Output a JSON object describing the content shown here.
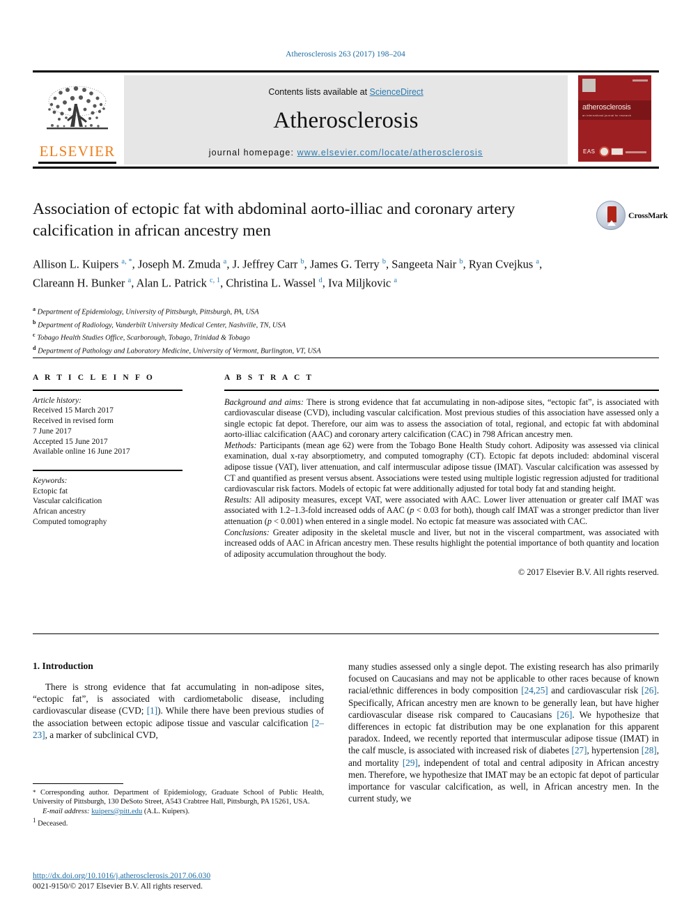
{
  "running_head": "Atherosclerosis 263 (2017) 198–204",
  "masthead": {
    "contents_prefix": "Contents lists available at ",
    "sciencedirect": "ScienceDirect",
    "journal_name": "Atherosclerosis",
    "homepage_prefix": "journal homepage: ",
    "homepage_url": "www.elsevier.com/locate/atherosclerosis",
    "publisher_logo_text": "ELSEVIER",
    "cover": {
      "title": "atherosclerosis",
      "subtitle": "an international journal for research",
      "badge": "EAS"
    },
    "accent_blue": "#2a7ab0",
    "elsevier_orange": "#ef7d1a",
    "cover_red": "#9d1f22"
  },
  "article": {
    "title": "Association of ectopic fat with abdominal aorto-illiac and coronary artery calcification in african ancestry men",
    "crossmark_label": "CrossMark",
    "authors_html": "Allison L. Kuipers <sup>a, *</sup>, Joseph M. Zmuda <sup>a</sup>, J. Jeffrey Carr <sup>b</sup>, James G. Terry <sup>b</sup>, Sangeeta Nair <sup>b</sup>, Ryan Cvejkus <sup>a</sup>, Clareann H. Bunker <sup>a</sup>, Alan L. Patrick <sup>c, 1</sup>, Christina L. Wassel <sup>d</sup>, Iva Miljkovic <sup>a</sup>",
    "affiliations": [
      {
        "marker": "a",
        "text": "Department of Epidemiology, University of Pittsburgh, Pittsburgh, PA, USA"
      },
      {
        "marker": "b",
        "text": "Department of Radiology, Vanderbilt University Medical Center, Nashville, TN, USA"
      },
      {
        "marker": "c",
        "text": "Tobago Health Studies Office, Scarborough, Tobago, Trinidad & Tobago"
      },
      {
        "marker": "d",
        "text": "Department of Pathology and Laboratory Medicine, University of Vermont, Burlington, VT, USA"
      }
    ]
  },
  "article_info": {
    "heading": "A R T I C L E   I N F O",
    "history_label": "Article history:",
    "history": [
      "Received 15 March 2017",
      "Received in revised form",
      "7 June 2017",
      "Accepted 15 June 2017",
      "Available online 16 June 2017"
    ],
    "keywords_label": "Keywords:",
    "keywords": [
      "Ectopic fat",
      "Vascular calcification",
      "African ancestry",
      "Computed tomography"
    ]
  },
  "abstract": {
    "heading": "A B S T R A C T",
    "background_label": "Background and aims:",
    "background_text": " There is strong evidence that fat accumulating in non-adipose sites, “ectopic fat”, is associated with cardiovascular disease (CVD), including vascular calcification. Most previous studies of this association have assessed only a single ectopic fat depot. Therefore, our aim was to assess the association of total, regional, and ectopic fat with abdominal aorto-illiac calcification (AAC) and coronary artery calcification (CAC) in 798 African ancestry men.",
    "methods_label": "Methods:",
    "methods_text": " Participants (mean age 62) were from the Tobago Bone Health Study cohort. Adiposity was assessed via clinical examination, dual x-ray absorptiometry, and computed tomography (CT). Ectopic fat depots included: abdominal visceral adipose tissue (VAT), liver attenuation, and calf intermuscular adipose tissue (IMAT). Vascular calcification was assessed by CT and quantified as present versus absent. Associations were tested using multiple logistic regression adjusted for traditional cardiovascular risk factors. Models of ectopic fat were additionally adjusted for total body fat and standing height.",
    "results_label": "Results:",
    "results_text_1": " All adiposity measures, except VAT, were associated with AAC. Lower liver attenuation or greater calf IMAT was associated with 1.2–1.3-fold increased odds of AAC (",
    "results_p1": "p",
    "results_text_2": " < 0.03 for both), though calf IMAT was a stronger predictor than liver attenuation (",
    "results_p2": "p",
    "results_text_3": " < 0.001) when entered in a single model. No ectopic fat measure was associated with CAC.",
    "conclusions_label": "Conclusions:",
    "conclusions_text": " Greater adiposity in the skeletal muscle and liver, but not in the visceral compartment, was associated with increased odds of AAC in African ancestry men. These results highlight the potential importance of both quantity and location of adiposity accumulation throughout the body.",
    "copyright": "© 2017 Elsevier B.V. All rights reserved."
  },
  "introduction": {
    "heading": "1. Introduction",
    "left_part_1": "There is strong evidence that fat accumulating in non-adipose sites, “ectopic fat”, is associated with cardiometabolic disease, including cardiovascular disease (CVD; ",
    "ref_1": "[1]",
    "left_part_2": "). While there have been previous studies of the association between ectopic adipose tissue and vascular calcification ",
    "ref_2_23": "[2–23]",
    "left_part_3": ", a marker of subclinical CVD,",
    "right_part_1": "many studies assessed only a single depot. The existing research has also primarily focused on Caucasians and may not be applicable to other races because of known racial/ethnic differences in body composition ",
    "ref_24_25": "[24,25]",
    "right_part_2": " and cardiovascular risk ",
    "ref_26a": "[26]",
    "right_part_3": ". Specifically, African ancestry men are known to be generally lean, but have higher cardiovascular disease risk compared to Caucasians ",
    "ref_26b": "[26]",
    "right_part_4": ". We hypothesize that differences in ectopic fat distribution may be one explanation for this apparent paradox. Indeed, we recently reported that intermuscular adipose tissue (IMAT) in the calf muscle, is associated with increased risk of diabetes ",
    "ref_27": "[27]",
    "right_part_5": ", hypertension ",
    "ref_28": "[28]",
    "right_part_6": ", and mortality ",
    "ref_29": "[29]",
    "right_part_7": ", independent of total and central adiposity in African ancestry men. Therefore, we hypothesize that IMAT may be an ectopic fat depot of particular importance for vascular calcification, as well, in African ancestry men. In the current study, we"
  },
  "footnotes": {
    "corresponding_marker": "*",
    "corresponding_text": " Corresponding author. Department of Epidemiology, Graduate School of Public Health, University of Pittsburgh, 130 DeSoto Street, A543 Crabtree Hall, Pittsburgh, PA 15261, USA.",
    "email_label": "E-mail address:",
    "email": "kuipers@pitt.edu",
    "email_suffix": " (A.L. Kuipers).",
    "deceased_marker": "1",
    "deceased_text": " Deceased."
  },
  "footer": {
    "doi": "http://dx.doi.org/10.1016/j.atherosclerosis.2017.06.030",
    "issn_line": "0021-9150/© 2017 Elsevier B.V. All rights reserved."
  }
}
